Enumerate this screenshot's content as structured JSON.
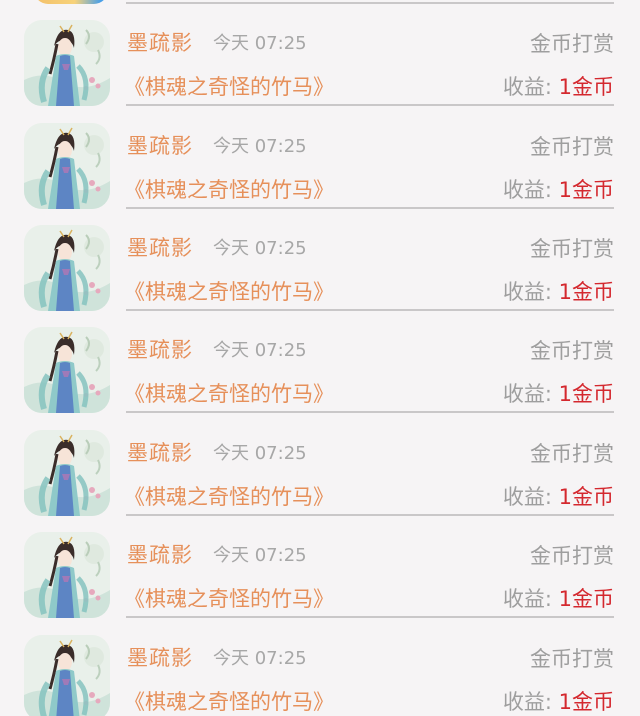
{
  "feed": {
    "items": [
      {
        "name": "墨疏影",
        "time": "今天 07:25",
        "action": "金币打赏",
        "book": "《棋魂之奇怪的竹马》",
        "earn_label": "收益: ",
        "earn_value": "1金币"
      },
      {
        "name": "墨疏影",
        "time": "今天 07:25",
        "action": "金币打赏",
        "book": "《棋魂之奇怪的竹马》",
        "earn_label": "收益: ",
        "earn_value": "1金币"
      },
      {
        "name": "墨疏影",
        "time": "今天 07:25",
        "action": "金币打赏",
        "book": "《棋魂之奇怪的竹马》",
        "earn_label": "收益: ",
        "earn_value": "1金币"
      },
      {
        "name": "墨疏影",
        "time": "今天 07:25",
        "action": "金币打赏",
        "book": "《棋魂之奇怪的竹马》",
        "earn_label": "收益: ",
        "earn_value": "1金币"
      },
      {
        "name": "墨疏影",
        "time": "今天 07:25",
        "action": "金币打赏",
        "book": "《棋魂之奇怪的竹马》",
        "earn_label": "收益: ",
        "earn_value": "1金币"
      },
      {
        "name": "墨疏影",
        "time": "今天 07:25",
        "action": "金币打赏",
        "book": "《棋魂之奇怪的竹马》",
        "earn_label": "收益: ",
        "earn_value": "1金币"
      },
      {
        "name": "墨疏影",
        "time": "今天 07:25",
        "action": "金币打赏",
        "book": "《棋魂之奇怪的竹马》",
        "earn_label": "收益: ",
        "earn_value": "1金币"
      }
    ]
  },
  "colors": {
    "background": "#f6f4f5",
    "name_orange": "#e6905a",
    "earn_red": "#d4282e",
    "muted_gray": "#9e9e9e",
    "divider": "#c9c7c8"
  },
  "icons": {
    "avatar": "user-avatar-ancient-lady-illustration"
  }
}
